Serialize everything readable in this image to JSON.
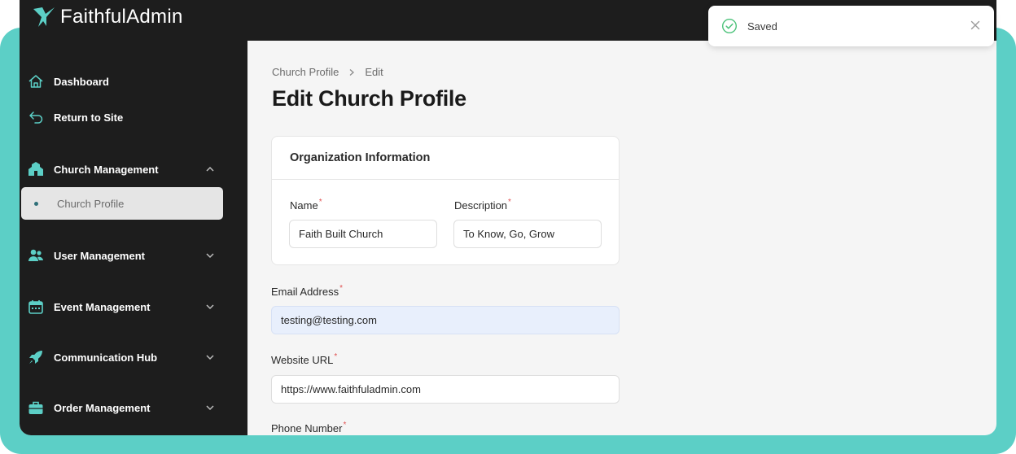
{
  "brand": {
    "name": "FaithfulAdmin",
    "logo_icon": "dove-logo-icon"
  },
  "colors": {
    "accent": "#5ccfc6",
    "sidebar_bg": "#1d1d1d",
    "required": "#e05252",
    "success": "#4cc27a"
  },
  "sidebar": {
    "items": [
      {
        "label": "Dashboard",
        "icon": "home-icon"
      },
      {
        "label": "Return to Site",
        "icon": "return-arrow-icon"
      },
      {
        "label": "Church Management",
        "icon": "church-icon",
        "expanded": true,
        "children": [
          {
            "label": "Church Profile",
            "active": true
          }
        ]
      },
      {
        "label": "User Management",
        "icon": "users-icon",
        "expanded": false
      },
      {
        "label": "Event Management",
        "icon": "calendar-icon",
        "expanded": false
      },
      {
        "label": "Communication Hub",
        "icon": "rocket-icon",
        "expanded": false
      },
      {
        "label": "Order Management",
        "icon": "briefcase-icon",
        "expanded": false
      }
    ]
  },
  "breadcrumb": {
    "items": [
      "Church Profile",
      "Edit"
    ]
  },
  "page": {
    "title": "Edit Church Profile"
  },
  "form": {
    "card_title": "Organization Information",
    "name": {
      "label": "Name",
      "value": "Faith Built Church"
    },
    "description": {
      "label": "Description",
      "value": "To Know, Go, Grow"
    },
    "email": {
      "label": "Email Address",
      "value": "testing@testing.com"
    },
    "website": {
      "label": "Website URL",
      "value": "https://www.faithfuladmin.com"
    },
    "phone": {
      "label": "Phone Number"
    },
    "required_mark": "*"
  },
  "toast": {
    "message": "Saved",
    "icon": "check-circle-icon"
  }
}
